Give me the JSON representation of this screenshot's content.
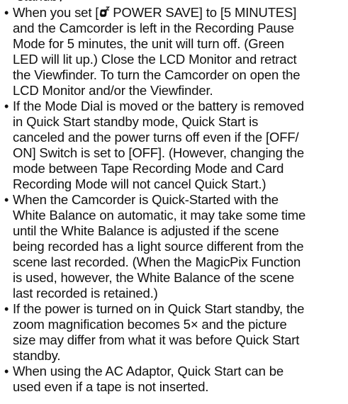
{
  "top_fragment": "standby",
  "notes": [
    {
      "lines": [
        {
          "before": "When you set [ ",
          "icon": "power-save-icon",
          "after": " POWER SAVE] to [5 MINUTES]"
        },
        "and the Camcorder is left in the Recording Pause",
        "Mode for 5 minutes, the unit will turn off. (Green",
        "LED will lit up.) Close the LCD Monitor and retract",
        "the Viewfinder. To turn the Camcorder on open the",
        "LCD Monitor and/or the Viewfinder."
      ]
    },
    {
      "lines": [
        "If the Mode Dial is moved or the battery is removed",
        "in Quick Start standby mode, Quick Start is",
        "canceled and the power turns off even if the [OFF/",
        "ON] Switch is set to [OFF]. (However, changing the",
        "mode between Tape Recording Mode and Card",
        "Recording Mode will not cancel Quick Start.)"
      ]
    },
    {
      "lines": [
        "When the Camcorder is Quick-Started with the",
        "White Balance on automatic, it may take some time",
        "until the White Balance is adjusted if the scene",
        "being recorded has a light source different from the",
        "scene last recorded. (When the MagicPix Function",
        "is used, however, the White Balance of the scene",
        "last recorded is retained.)"
      ]
    },
    {
      "lines": [
        "If the power is turned on in Quick Start standby, the",
        "zoom magnification becomes 5× and the picture",
        "size may differ from what it was before Quick Start",
        "standby."
      ]
    },
    {
      "lines": [
        "When using the AC Adaptor, Quick Start can be",
        "used even if a tape is not inserted."
      ]
    }
  ],
  "bullet_char": "•",
  "text_color": "#111111"
}
